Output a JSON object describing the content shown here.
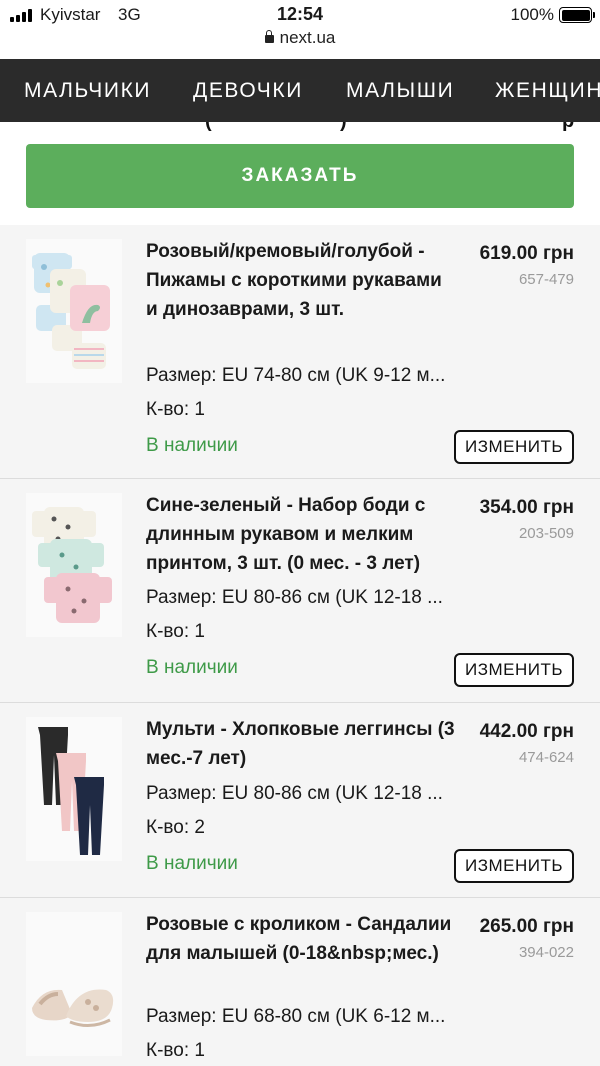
{
  "status_bar": {
    "carrier": "Kyivstar",
    "network": "3G",
    "time": "12:54",
    "battery": "100%"
  },
  "browser": {
    "url": "next.ua"
  },
  "nav": {
    "items": [
      "МАЛЬЧИКИ",
      "ДЕВОЧКИ",
      "МАЛЫШИ",
      "ЖЕНЩИН"
    ]
  },
  "top_cut": {
    "left": "(",
    "middle": ")",
    "right": "р"
  },
  "checkout": {
    "order_label": "ЗАКАЗАТЬ"
  },
  "items": [
    {
      "name": "Розовый/кремовый/голубой - Пижамы с короткими рукавами и динозаврами, 3 шт.",
      "price": "619.00 грн",
      "code": "657-479",
      "size": "Размер: EU 74-80 см (UK 9-12 м...",
      "qty": "К-во: 1",
      "stock": "В наличии",
      "edit": "ИЗМЕНИТЬ"
    },
    {
      "name": "Сине-зеленый - Набор боди с длинным рукавом и мелким принтом, 3 шт. (0 мес. - 3 лет)",
      "price": "354.00 грн",
      "code": "203-509",
      "size": "Размер: EU 80-86 см (UK 12-18 ...",
      "qty": "К-во: 1",
      "stock": "В наличии",
      "edit": "ИЗМЕНИТЬ"
    },
    {
      "name": "Мульти - Хлопковые леггинсы (3 мес.-7 лет)",
      "price": "442.00 грн",
      "code": "474-624",
      "size": "Размер: EU 80-86 см (UK 12-18 ...",
      "qty": "К-во: 2",
      "stock": "В наличии",
      "edit": "ИЗМЕНИТЬ"
    },
    {
      "name": "Розовые с кроликом - Сандалии для малышей (0-18&nbsp;мес.)",
      "price": "265.00 грн",
      "code": "394-022",
      "size": "Размер: EU 68-80 см (UK 6-12 м...",
      "qty": "К-во: 1"
    }
  ],
  "colors": {
    "nav_bg": "#2b2b2b",
    "order_button": "#5cae5c",
    "in_stock": "#3e9a48",
    "list_bg": "#f5f5f5"
  }
}
